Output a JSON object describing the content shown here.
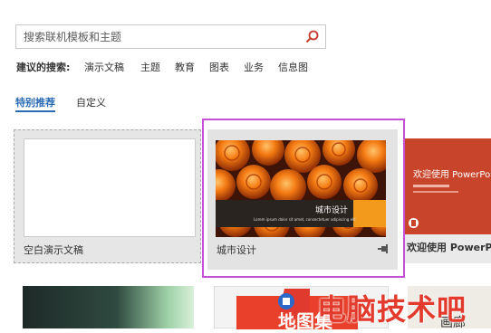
{
  "search": {
    "placeholder": "搜索联机模板和主题"
  },
  "suggested": {
    "label": "建议的搜索:",
    "items": [
      "演示文稿",
      "主题",
      "教育",
      "图表",
      "业务",
      "信息图"
    ]
  },
  "tabs": {
    "featured": "特别推荐",
    "custom": "自定义"
  },
  "templates": [
    {
      "name": "空白演示文稿"
    },
    {
      "name": "城市设计",
      "thumb_title": "城市设计",
      "thumb_sub": "Lorem ipsum dolor sit amet, consectetuer adipiscing elit"
    },
    {
      "name": "欢迎使用 PowerPoint",
      "thumb_title": "欢迎使用 PowerPo"
    }
  ],
  "row2": {
    "b_text": "地图集",
    "c_text": "画廊"
  },
  "watermark": {
    "text": "电脑技术吧"
  },
  "colors": {
    "accent": "#2b6cb5",
    "selection": "#c64fd8",
    "welcome": "#c8452b",
    "orange": "#f39a1c"
  }
}
